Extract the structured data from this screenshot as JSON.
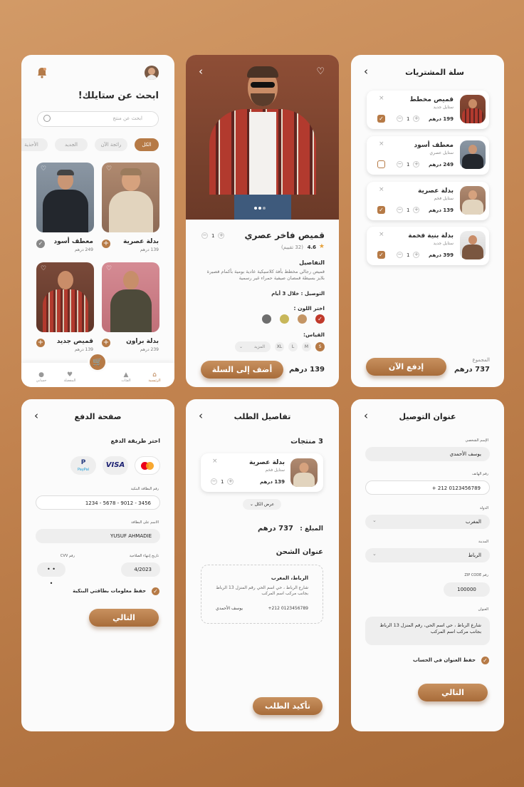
{
  "home": {
    "title": "ابحث عن ستايلك!",
    "search_placeholder": "ابحث عن منتج",
    "chips": [
      "الكل",
      "رائجة الآن",
      "الجديد",
      "الأحذية"
    ],
    "products": [
      {
        "name": "بدلة عصرية",
        "price": "139 درهم"
      },
      {
        "name": "معطف أسود",
        "price": "249 درهم"
      },
      {
        "name": "بدلة براون",
        "price": "239 درهم"
      },
      {
        "name": "قميص جديد",
        "price": "139 درهم"
      }
    ],
    "nav": [
      "الرئيسية",
      "الفئات",
      "المفضلة",
      "حسابي"
    ]
  },
  "product": {
    "name": "قميص فاخر عصري",
    "rating": "4.6",
    "reviews": "(32 تقييم)",
    "qty": "1",
    "details_title": "التفاصيل",
    "details": "قميص رجالي مخطط بأفة كلاسيكية عادية بومية بأكمام قصيرة بلايز بسيطة قمصان صيفية حمراء غير رسمية",
    "delivery": "التوصيل : خلال 3 أيام",
    "color_title": "اختر اللون :",
    "colors": [
      "#c0392b",
      "#c49565",
      "#c8b75a",
      "#6e6e6e"
    ],
    "size_title": "القياس:",
    "sizes": [
      "S",
      "M",
      "L",
      "XL"
    ],
    "more": "المزيد",
    "price": "139 درهم",
    "add_btn": "أضف إلى السلة"
  },
  "cart": {
    "title": "سلة المشتريات",
    "items": [
      {
        "name": "قميص مخطط",
        "sub": "ستايل جديد",
        "price": "199 درهم",
        "qty": "1",
        "checked": true
      },
      {
        "name": "معطف أسود",
        "sub": "ستايل عصري",
        "price": "249 درهم",
        "qty": "1",
        "checked": false
      },
      {
        "name": "بدلة عصرية",
        "sub": "ستايل فخم",
        "price": "139 درهم",
        "qty": "1",
        "checked": true
      },
      {
        "name": "بدلة بنية فخمة",
        "sub": "ستايل جديد",
        "price": "399 درهم",
        "qty": "1",
        "checked": true
      }
    ],
    "total_label": "المجموع",
    "total": "737 درهم",
    "pay_btn": "إدفع الآن"
  },
  "payment": {
    "title": "صفحة الدفع",
    "method_title": "اختر طريقة الدفع",
    "brands": [
      "PayPal",
      "VISA"
    ],
    "card_number_label": "رقم البطاقة البنكية",
    "card_number": "1234 - 5678 - 9012 - 3456",
    "card_name_label": "الاسم على البطاقة",
    "card_name": "YUSUF AHMADIE",
    "expiry_label": "تاريخ إنتهاء الصلاحية",
    "expiry": "4/2023",
    "cvv_label": "رقم CVV",
    "cvv": "• • •",
    "save_label": "حفظ معلومات بطاقتي البنكية",
    "next_btn": "التالي"
  },
  "order": {
    "title": "تفاصيل الطلب",
    "count": "3 منتجات",
    "item_name": "بدلة عصرية",
    "item_sub": "ستايل فخم",
    "item_price": "139 درهم",
    "item_qty": "1",
    "view_all": "عرض الكل",
    "amount_label": "المبلغ :",
    "amount": "737 درهم",
    "ship_title": "عنوان الشحن",
    "ship_city": "الرباط، المغرب",
    "ship_addr": "شارع الرباط ، حي اسم الحي رقم المنزل 13 الرباط بجانب مركب اسم المركب",
    "ship_phone": "+212 0123456789",
    "ship_name": "يوسف الأحمدي",
    "confirm_btn": "تأكيد الطلب"
  },
  "address": {
    "title": "عنوان التوصيل",
    "name_label": "الإسم الشخصي",
    "name": "يوسف الأحمدي",
    "phone_label": "رقم الهاتف",
    "phone": "+ 212 0123456789",
    "country_label": "الدولة",
    "country": "المغرب",
    "city_label": "المدينة",
    "city": "الرباط",
    "zip_label": "رقم ZIP CODE",
    "zip": "100000",
    "addr_label": "العنوان",
    "addr": "شارع الرباط ، حي اسم الحي، رقم المنزل 13 الرباط بجانب مركب اسم المركب",
    "save_label": "حفظ العنوان في الحساب",
    "next_btn": "التالي"
  }
}
